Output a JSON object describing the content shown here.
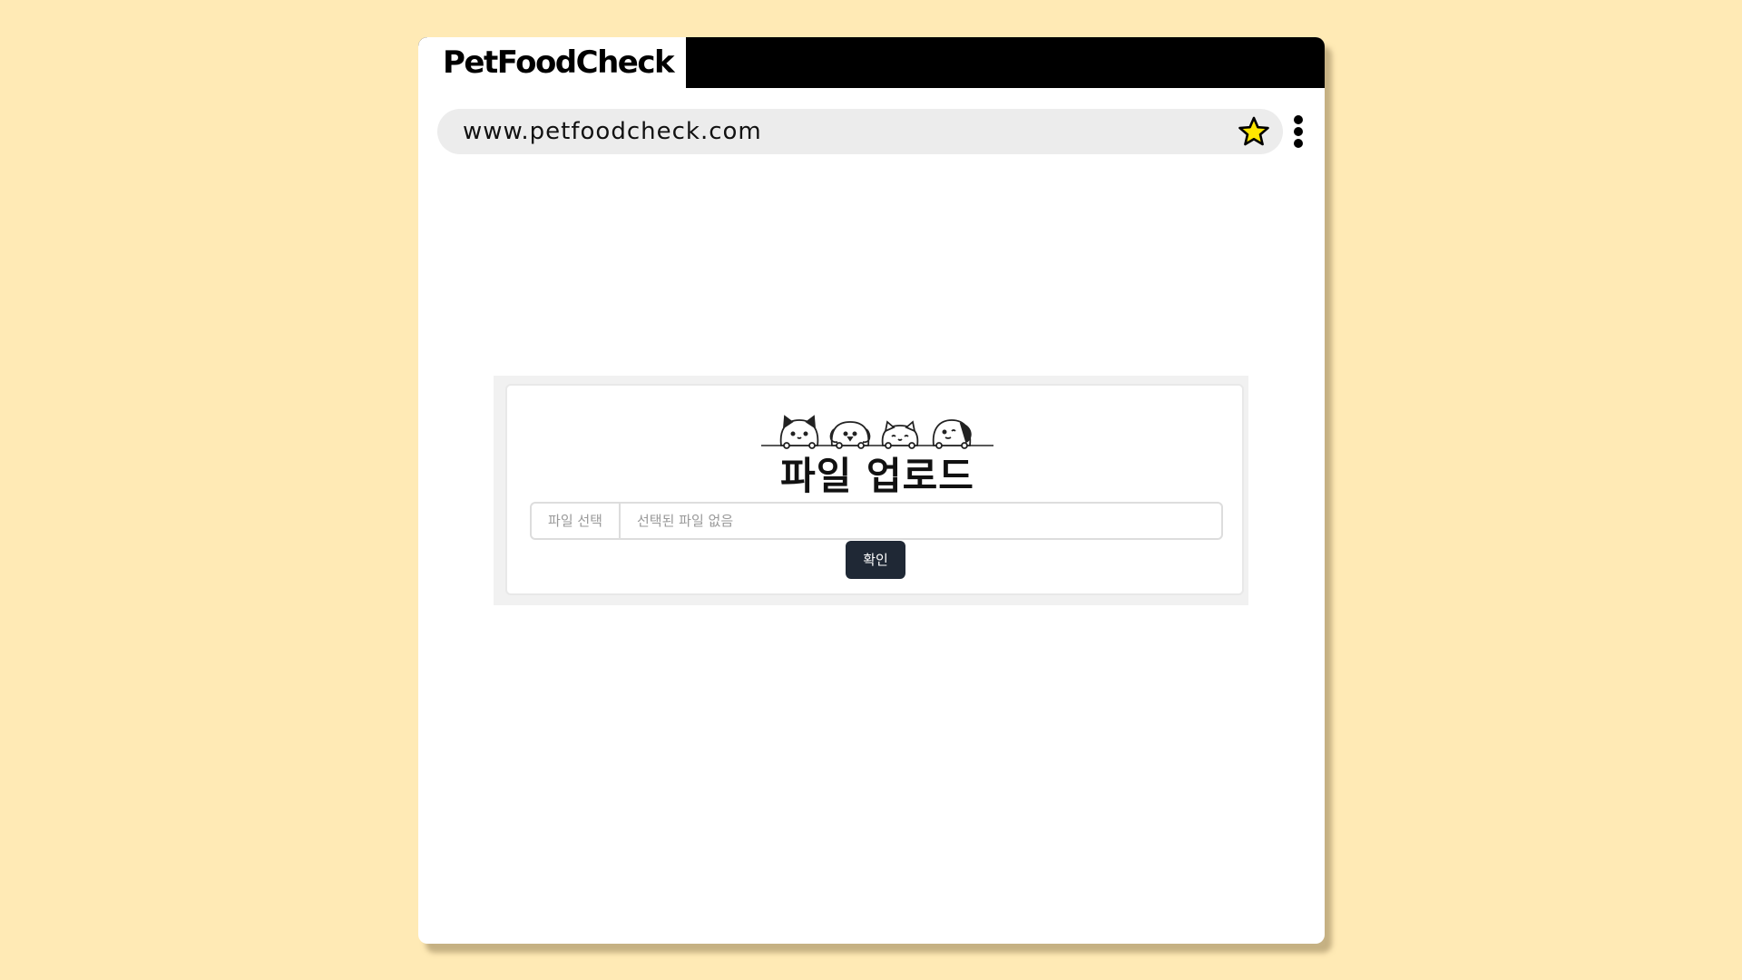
{
  "browser": {
    "tab_title": "PetFoodCheck",
    "url": "www.petfoodcheck.com",
    "bookmark_icon": "star-icon",
    "menu_icon": "kebab-menu-icon"
  },
  "upload": {
    "title": "파일 업로드",
    "banner_icons": [
      "cat-icon",
      "dog-icon",
      "cat-icon",
      "dog-icon"
    ],
    "file_button_label": "파일 선택",
    "file_status": "선택된 파일 없음",
    "confirm_label": "확인"
  },
  "colors": {
    "background": "#FFEAB5",
    "star_fill": "#FFE600",
    "confirm_button": "#1f2835"
  }
}
